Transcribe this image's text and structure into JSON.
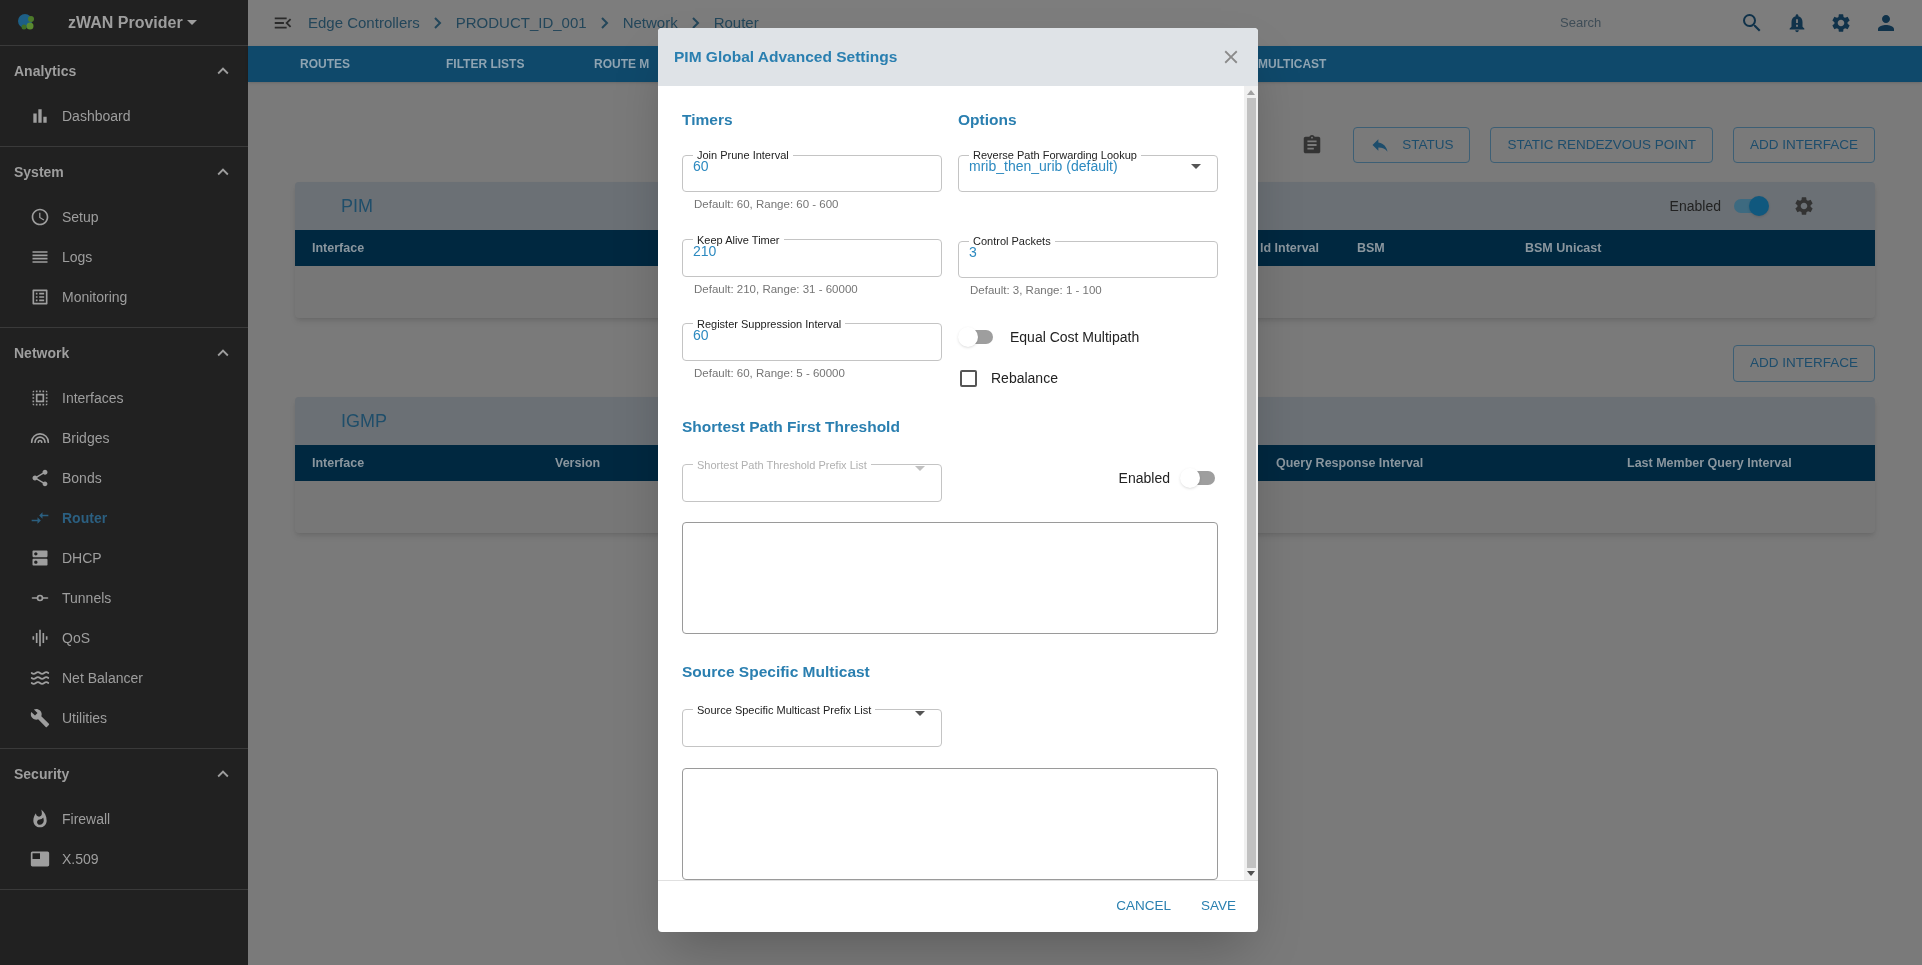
{
  "sidebar": {
    "brand": "zWAN Provider",
    "sections": [
      {
        "title": "Analytics",
        "expanded": true,
        "items": [
          {
            "label": "Dashboard",
            "selected": false
          }
        ]
      },
      {
        "title": "System",
        "expanded": true,
        "items": [
          {
            "label": "Setup",
            "selected": false
          },
          {
            "label": "Logs",
            "selected": false
          },
          {
            "label": "Monitoring",
            "selected": false
          }
        ]
      },
      {
        "title": "Network",
        "expanded": true,
        "items": [
          {
            "label": "Interfaces",
            "selected": false
          },
          {
            "label": "Bridges",
            "selected": false
          },
          {
            "label": "Bonds",
            "selected": false
          },
          {
            "label": "Router",
            "selected": true
          },
          {
            "label": "DHCP",
            "selected": false
          },
          {
            "label": "Tunnels",
            "selected": false
          },
          {
            "label": "QoS",
            "selected": false
          },
          {
            "label": "Net Balancer",
            "selected": false
          },
          {
            "label": "Utilities",
            "selected": false
          }
        ]
      },
      {
        "title": "Security",
        "expanded": true,
        "items": [
          {
            "label": "Firewall",
            "selected": false
          },
          {
            "label": "X.509",
            "selected": false
          }
        ]
      }
    ]
  },
  "top_bar": {
    "breadcrumb": [
      "Edge Controllers",
      "PRODUCT_ID_001",
      "Network",
      "Router"
    ],
    "search": {
      "placeholder": "Search"
    }
  },
  "tabs": [
    {
      "label": "ROUTES"
    },
    {
      "label": "FILTER LISTS"
    },
    {
      "label": "ROUTE M"
    },
    {
      "label": "MULTICAST"
    }
  ],
  "toolbar": {
    "buttons": [
      "STATUS",
      "STATIC RENDEZVOUS POINT",
      "ADD INTERFACE"
    ]
  },
  "pim_card": {
    "title": "PIM",
    "enabled_label": "Enabled",
    "enabled": true,
    "columns": [
      "Interface",
      "ld Interval",
      "BSM",
      "BSM Unicast"
    ]
  },
  "igmp_toolbar": {
    "buttons": [
      "ADD INTERFACE"
    ]
  },
  "igmp_card": {
    "title": "IGMP",
    "columns": [
      "Interface",
      "Version",
      "Query Response Interval",
      "Last Member Query Interval"
    ]
  },
  "dialog": {
    "title": "PIM Global Advanced Settings",
    "timers": {
      "heading": "Timers",
      "fields": [
        {
          "label": "Join Prune Interval",
          "value": "60",
          "helper": "Default: 60, Range: 60 - 600"
        },
        {
          "label": "Keep Alive Timer",
          "value": "210",
          "helper": "Default: 210, Range: 31 - 60000"
        },
        {
          "label": "Register Suppression Interval",
          "value": "60",
          "helper": "Default: 60, Range: 5 - 60000"
        }
      ]
    },
    "options": {
      "heading": "Options",
      "rpf_select": {
        "label": "Reverse Path Forwarding Lookup",
        "value": "mrib_then_urib (default)"
      },
      "control_packets": {
        "label": "Control Packets",
        "value": "3",
        "helper": "Default: 3, Range: 1 - 100"
      },
      "ecmp": {
        "label": "Equal Cost Multipath",
        "on": false
      },
      "rebalance": {
        "label": "Rebalance",
        "checked": false
      }
    },
    "spt": {
      "heading": "Shortest Path First Threshold",
      "select": {
        "label": "Shortest Path Threshold Prefix List",
        "disabled": true
      },
      "enabled": {
        "label": "Enabled",
        "on": false
      }
    },
    "ssm": {
      "heading": "Source Specific Multicast",
      "select": {
        "label": "Source Specific Multicast Prefix List",
        "disabled": false
      }
    },
    "buttons": [
      "CANCEL",
      "SAVE"
    ]
  }
}
